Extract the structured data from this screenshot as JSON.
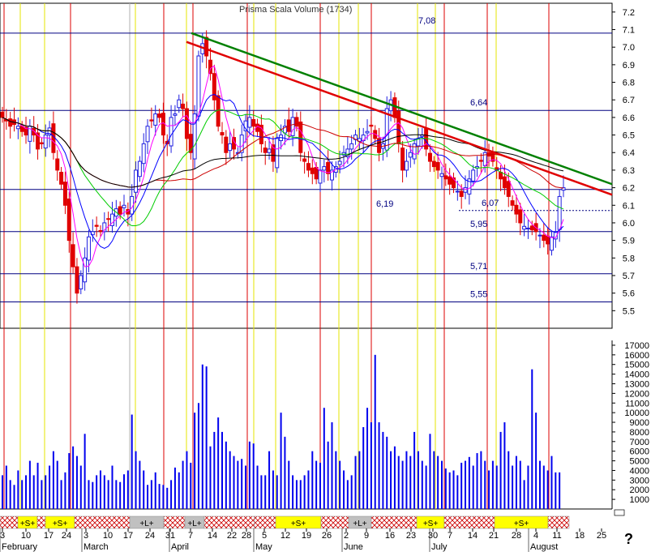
{
  "chart_data": {
    "type": "candlestick",
    "title_overlay": "Prisma Scala Volume (1734)",
    "price_axis": {
      "ylim": [
        5.4,
        7.25
      ],
      "ticks": [
        7.2,
        7.1,
        7.0,
        6.9,
        6.8,
        6.7,
        6.6,
        6.5,
        6.4,
        6.3,
        6.2,
        6.1,
        6.0,
        5.9,
        5.8,
        5.7,
        5.6,
        5.5
      ]
    },
    "volume_axis": {
      "ylim": [
        0,
        17500
      ],
      "ticks": [
        1000,
        2000,
        3000,
        4000,
        5000,
        6000,
        7000,
        8000,
        9000,
        10000,
        11000,
        12000,
        13000,
        14000,
        15000,
        16000,
        17000
      ]
    },
    "x_dates": [
      "3",
      "10",
      "17",
      "24",
      "3",
      "10",
      "17",
      "24",
      "31",
      "7",
      "14",
      "22",
      "28",
      "5",
      "12",
      "19",
      "26",
      "2",
      "9",
      "16",
      "23",
      "30",
      "7",
      "14",
      "21",
      "28",
      "4",
      "11",
      "18",
      "25"
    ],
    "months": [
      "February",
      "March",
      "April",
      "May",
      "June",
      "July",
      "August"
    ],
    "levels": [
      {
        "label": "7,08",
        "value": 7.08
      },
      {
        "label": "6,64",
        "value": 6.64
      },
      {
        "label": "6,19",
        "value": 6.19
      },
      {
        "label": "6,07",
        "value": 6.07
      },
      {
        "label": "5,95",
        "value": 5.95
      },
      {
        "label": "5,71",
        "value": 5.71
      },
      {
        "label": "5,55",
        "value": 5.55
      }
    ],
    "trendlines": [
      {
        "name": "green",
        "color": "#008000",
        "from_value": 7.08,
        "to_value": 6.22
      },
      {
        "name": "red",
        "color": "#e00000",
        "from_value": 7.03,
        "to_value": 6.16
      }
    ],
    "signal_labels": [
      "+S+",
      "+S+",
      "+L+",
      "+L+",
      "+S+",
      "+L+",
      "+S+",
      "+S+"
    ],
    "help_label": "?",
    "colors": {
      "up": "#2020e0",
      "down": "#e00000",
      "volume": "#0000ee",
      "level_line": "#000080",
      "signal_yellow": "#ffff00",
      "signal_gray": "#c0c0c0",
      "ma_short": "#ff00ff",
      "ma_mid": "#0000ff",
      "ma_long1": "#00cc00",
      "ma_long2": "#cc0000",
      "ma_long3": "#000000"
    }
  }
}
